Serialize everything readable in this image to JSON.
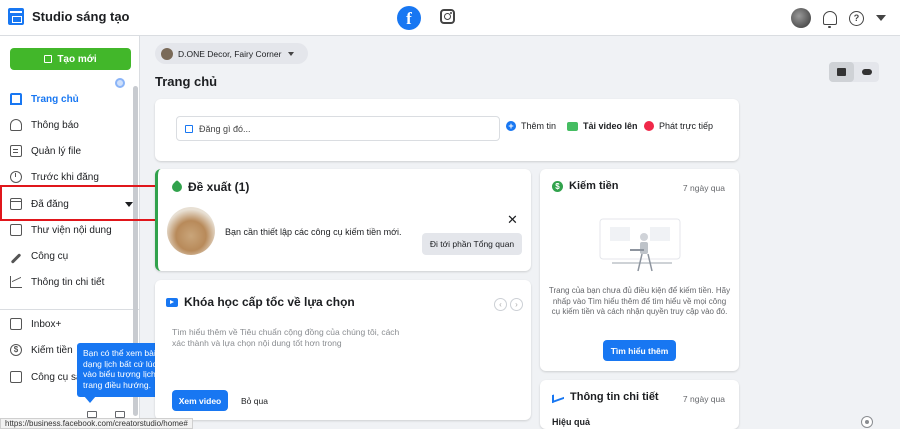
{
  "app": {
    "title": "Studio sáng tạo"
  },
  "top_icons": {
    "facebook": "facebook-icon",
    "instagram": "instagram-icon"
  },
  "sidebar": {
    "create_label": "Tạo mới",
    "items": [
      {
        "label": "Trang chủ",
        "icon": "home-icon"
      },
      {
        "label": "Thông báo",
        "icon": "bell-icon"
      },
      {
        "label": "Quản lý file",
        "icon": "file-icon"
      },
      {
        "label": "Trước khi đăng",
        "icon": "clock-icon"
      },
      {
        "label": "Đã đăng",
        "icon": "calendar-icon"
      },
      {
        "label": "Thư viện nội dung",
        "icon": "library-icon"
      },
      {
        "label": "Công cụ",
        "icon": "tools-icon"
      },
      {
        "label": "Thông tin chi tiết",
        "icon": "insights-icon"
      },
      {
        "label": "Inbox+",
        "icon": "inbox-icon"
      },
      {
        "label": "Kiếm tiền",
        "icon": "money-icon"
      },
      {
        "label": "Công cụ sá",
        "icon": "creator-tools-icon"
      }
    ]
  },
  "tooltip": {
    "text": "Bạn có thể xem bài viết của mình ở dạng lịch bất cứ lúc nào bằng cách nhấp vào biểu tượng lịch trong phần chân trang điều hướng.",
    "close": "×"
  },
  "statusbar": {
    "url": "https://business.facebook.com/creatorstudio/home#"
  },
  "main": {
    "page_selector": "D.ONE Decor, Fairy Corner",
    "title": "Trang chủ",
    "compose": {
      "placeholder": "Đăng gì đó...",
      "actions": [
        "Thêm tin",
        "Tải video lên",
        "Phát trực tiếp"
      ]
    },
    "suggest": {
      "title": "Đề xuất (1)",
      "text": "Bạn cần thiết lập các công cụ kiếm tiền mới.",
      "button": "Đi tới phần Tổng quan",
      "close": "✕"
    },
    "course": {
      "title": "Khóa học cấp tốc về lựa chọn",
      "desc": "Tìm hiểu thêm về Tiêu chuẩn cộng đồng của chúng tôi, cách xác thành và lựa chọn nội dung tốt hơn trong",
      "primary": "Xem video",
      "secondary": "Bỏ qua"
    },
    "money": {
      "title": "Kiếm tiền",
      "time": "7 ngày qua",
      "desc": "Trang của bạn chưa đủ điều kiện để kiếm tiền. Hãy nhấp vào Tìm hiểu thêm để tìm hiểu về mọi công cụ kiếm tiền và cách nhận quyền truy cập vào đó.",
      "button": "Tìm hiểu thêm"
    },
    "insights": {
      "title": "Thông tin chi tiết",
      "time": "7 ngày qua",
      "sub": "Hiệu quả"
    }
  },
  "colors": {
    "accent": "#1877f2",
    "create": "#42b72a",
    "highlight": "#e0161b"
  }
}
